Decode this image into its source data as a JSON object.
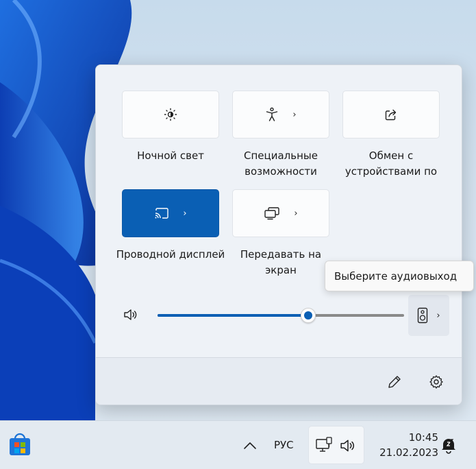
{
  "quick_settings": {
    "tiles": [
      {
        "id": "night-light",
        "label": "Ночной свет",
        "icon": "brightness-sun-icon",
        "has_chevron": false,
        "active": false
      },
      {
        "id": "accessibility",
        "label": "Специальные возможности",
        "icon": "accessibility-person-icon",
        "has_chevron": true,
        "active": false
      },
      {
        "id": "nearby-sharing",
        "label": "Обмен с устройствами по",
        "icon": "share-icon",
        "has_chevron": false,
        "active": false
      },
      {
        "id": "wired-display",
        "label": "Проводной дисплей",
        "icon": "cast-display-icon",
        "has_chevron": true,
        "active": true
      },
      {
        "id": "project",
        "label": "Передавать на экран",
        "icon": "project-screens-icon",
        "has_chevron": true,
        "active": false
      }
    ],
    "chevron": "›",
    "volume": {
      "level_percent": 61,
      "icon": "speaker-icon"
    },
    "audio_output_icon": "speaker-device-icon",
    "footer": {
      "edit_icon": "pencil-icon",
      "settings_icon": "gear-icon"
    }
  },
  "tooltip": {
    "text": "Выберите аудиовыход"
  },
  "taskbar": {
    "store_icon": "microsoft-store-icon",
    "overflow_icon": "chevron-up-icon",
    "language": "РУС",
    "tray_icons": [
      "network-monitor-icon",
      "speaker-icon"
    ],
    "time": "10:45",
    "date": "21.02.2023",
    "notification_icon": "bell-snooze-icon"
  },
  "colors": {
    "accent": "#0a5fb4",
    "flyout_bg": "#eef2f7",
    "taskbar_bg": "#e3eaf1"
  }
}
